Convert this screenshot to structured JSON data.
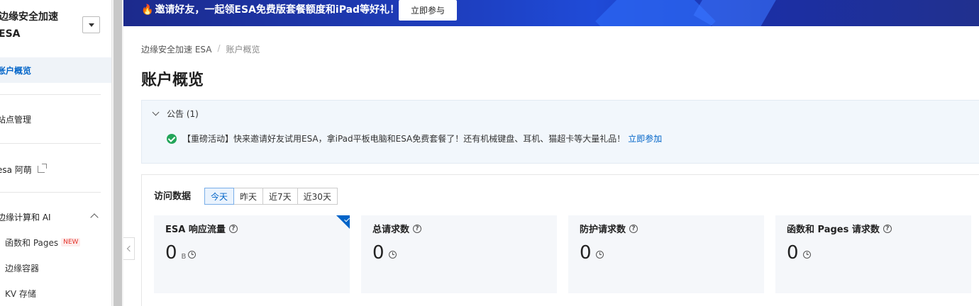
{
  "sidebar": {
    "title": "边缘安全加速 ESA",
    "items": {
      "overview": "账户概览",
      "sites": "站点管理",
      "esa_mascot": "esa 阿萌",
      "edge_compute": "边缘计算和 AI"
    },
    "subitems": {
      "functions_pages": "函数和 Pages",
      "new_badge": "NEW",
      "edge_container": "边缘容器",
      "kv_storage": "KV 存储"
    }
  },
  "banner": {
    "fire": "🔥",
    "text": "邀请好友，一起领ESA免费版套餐额度和iPad等好礼！",
    "button": "立即参与"
  },
  "breadcrumb": {
    "root": "边缘安全加速 ESA",
    "sep": "/",
    "current": "账户概览"
  },
  "page_title": "账户概览",
  "notice": {
    "heading": "公告 (1)",
    "body": "【重磅活动】快来邀请好友试用ESA，拿iPad平板电脑和ESA免费套餐了！还有机械键盘、耳机、猫超卡等大量礼品！",
    "link": "立即参加"
  },
  "access": {
    "title": "访问数据",
    "ranges": [
      "今天",
      "昨天",
      "近7天",
      "近30天"
    ],
    "active_range": "今天",
    "cards": [
      {
        "title": "ESA 响应流量",
        "value": "0",
        "unit": "B"
      },
      {
        "title": "总请求数",
        "value": "0",
        "unit": ""
      },
      {
        "title": "防护请求数",
        "value": "0",
        "unit": ""
      },
      {
        "title": "函数和 Pages 请求数",
        "value": "0",
        "unit": ""
      }
    ],
    "help_glyph": "?"
  },
  "colors": {
    "accent": "#0064c8",
    "banner": "#1e3fc0",
    "success": "#23a559"
  }
}
